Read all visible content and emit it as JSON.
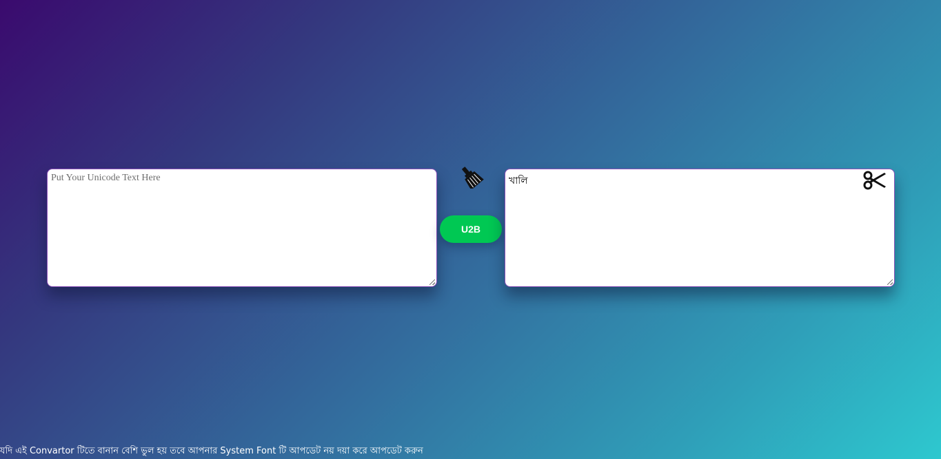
{
  "converter": {
    "input_placeholder": "Put Your Unicode Text Here",
    "input_value": "",
    "output_value": "খালি",
    "convert_label": "U2B",
    "clear_icon": "broom-icon",
    "cut_icon": "scissors-icon"
  },
  "footer": {
    "note": "যদি এই Convartor টিতে বানান বেশি ভুল হয় তবে আপনার System Font টি আপডেট নয় দয়া করে আপডেট করুন"
  },
  "colors": {
    "gradient_start": "#3a0a6e",
    "gradient_end": "#2ec8cf",
    "button": "#00c853",
    "textarea_border": "#8a4fb8"
  }
}
